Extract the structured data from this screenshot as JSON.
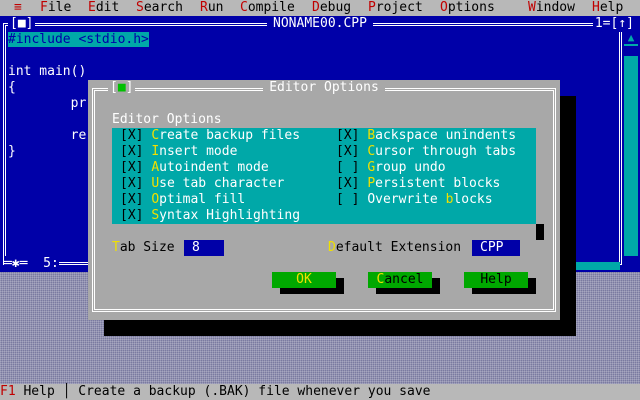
{
  "menubar": {
    "system_icon": "≡",
    "items": [
      {
        "hk": "F",
        "rest": "ile"
      },
      {
        "hk": "E",
        "rest": "dit"
      },
      {
        "hk": "S",
        "rest": "earch"
      },
      {
        "hk": "R",
        "rest": "un"
      },
      {
        "hk": "C",
        "rest": "ompile"
      },
      {
        "hk": "D",
        "rest": "ebug"
      },
      {
        "hk": "P",
        "rest": "roject"
      },
      {
        "hk": "O",
        "rest": "ptions"
      },
      {
        "hk": "W",
        "rest": "indow"
      },
      {
        "hk": "H",
        "rest": "elp"
      }
    ]
  },
  "editor": {
    "title": "NONAME00.CPP",
    "close_glyph": "[■]",
    "window_number": "1=[↑]",
    "code": {
      "line1": "#include <stdio.h>",
      "line2": "int main()",
      "line3": "{",
      "line4": "        pr",
      "line5": "        re",
      "line6": "}"
    },
    "status": "═✱═  5:"
  },
  "dialog": {
    "title": "Editor Options",
    "close_glyph": "■",
    "group_label": "Editor Options",
    "checkboxes": [
      {
        "box": "[X]",
        "hk": "C",
        "rest": "reate backup files",
        "pre": ""
      },
      {
        "box": "[X]",
        "hk": "I",
        "rest": "nsert mode",
        "pre": ""
      },
      {
        "box": "[X]",
        "hk": "A",
        "rest": "utoindent mode",
        "pre": ""
      },
      {
        "box": "[X]",
        "hk": "U",
        "rest": "se tab character",
        "pre": ""
      },
      {
        "box": "[X]",
        "hk": "O",
        "rest": "ptimal fill",
        "pre": ""
      },
      {
        "box": "[X]",
        "hk": "S",
        "rest": "yntax Highlighting",
        "pre": ""
      },
      {
        "box": "[X]",
        "hk": "B",
        "rest": "ackspace unindents",
        "pre": ""
      },
      {
        "box": "[X]",
        "hk": "C",
        "rest": "ursor through tabs",
        "pre": ""
      },
      {
        "box": "[ ]",
        "hk": "G",
        "rest": "roup undo",
        "pre": ""
      },
      {
        "box": "[X]",
        "hk": "P",
        "rest": "ersistent blocks",
        "pre": ""
      },
      {
        "box": "[ ]",
        "hk": "b",
        "rest": "locks",
        "pre": "Overwrite "
      }
    ],
    "tab_size": {
      "hk": "T",
      "rest": "ab Size",
      "value": "8"
    },
    "default_ext": {
      "hk": "D",
      "rest": "efault Extension",
      "value": "CPP"
    },
    "buttons": {
      "ok": "OK",
      "cancel_hk": "C",
      "cancel_rest": "ancel",
      "help": "Help"
    }
  },
  "statusline": {
    "key": "F1",
    "key_label": " Help",
    "separator": " │ ",
    "hint": "Create a backup (.BAK) file whenever you save"
  },
  "colors": {
    "editor_bg": "#0000a8",
    "dialog_bg": "#a8a8a8",
    "panel_bg": "#00a8a8",
    "button_bg": "#00a800",
    "hotkey_yellow": "#f0e000",
    "hotkey_red": "#c00000"
  }
}
